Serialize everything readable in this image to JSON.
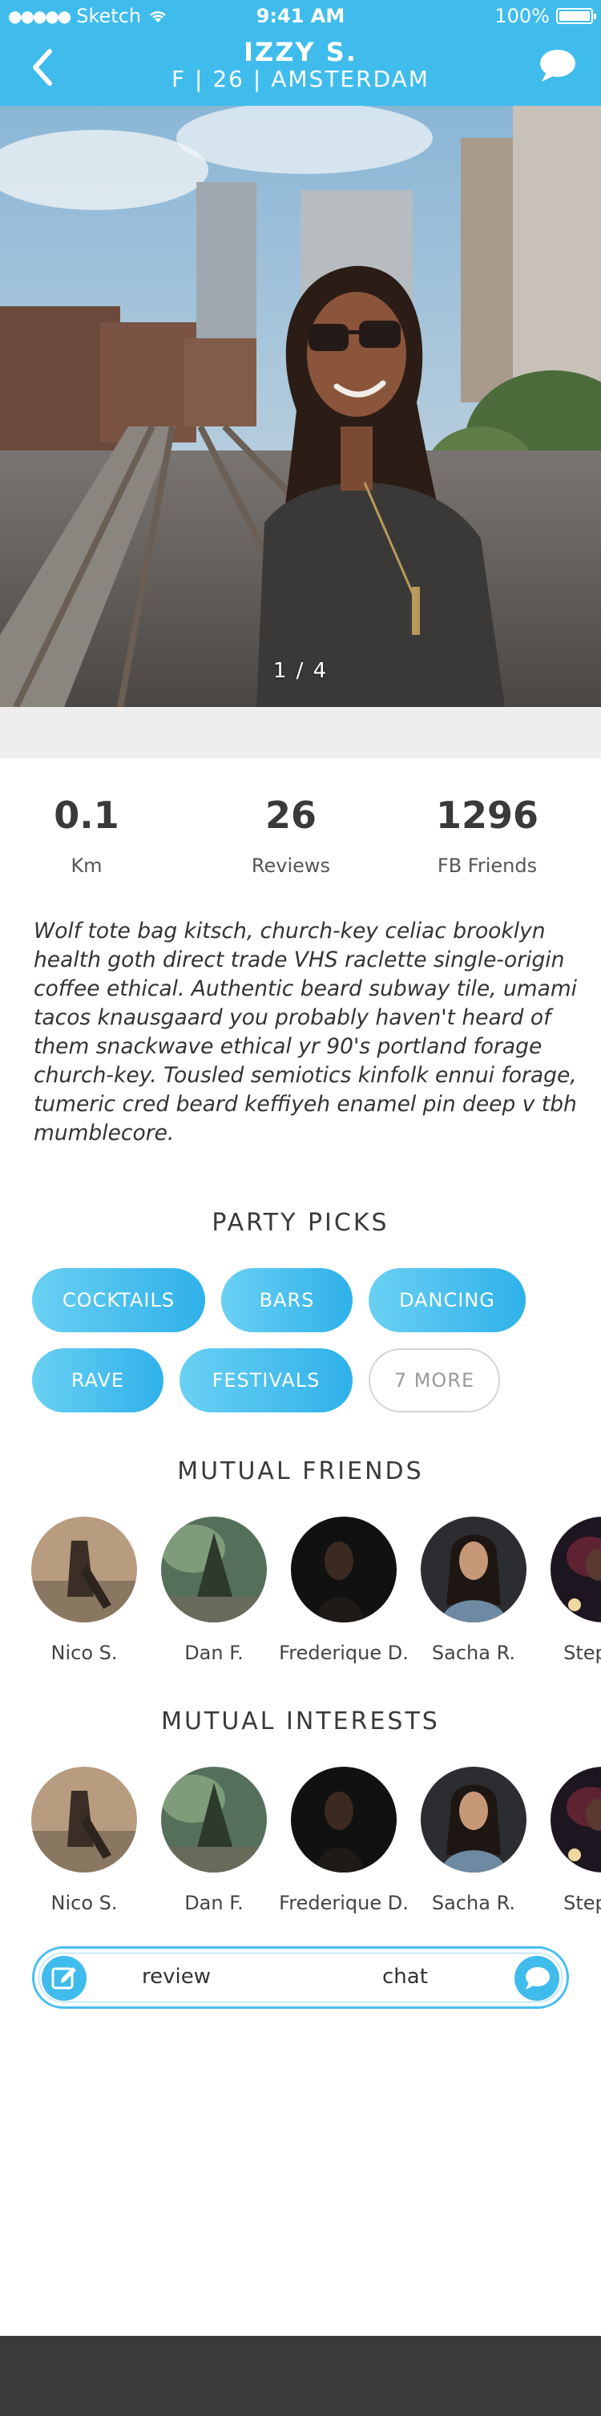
{
  "status_bar": {
    "carrier": "Sketch",
    "time": "9:41 AM",
    "battery": "100%"
  },
  "header": {
    "name": "IZZY S.",
    "subtitle": "F | 26 | AMSTERDAM"
  },
  "photo": {
    "counter": "1 / 4"
  },
  "stats": [
    {
      "value": "0.1",
      "label": "Km"
    },
    {
      "value": "26",
      "label": "Reviews"
    },
    {
      "value": "1296",
      "label": "FB Friends"
    }
  ],
  "bio": "Wolf tote bag kitsch, church-key celiac brooklyn health goth direct trade VHS raclette single-origin coffee ethical. Authentic beard subway tile, umami tacos knausgaard you probably haven't heard of them snackwave ethical yr 90's portland forage church-key. Tousled semiotics kinfolk ennui forage, tumeric cred beard keffiyeh enamel pin deep v tbh mumblecore.",
  "party_picks": {
    "title": "PARTY PICKS",
    "chips": [
      "COCKTAILS",
      "BARS",
      "DANCING",
      "RAVE",
      "FESTIVALS",
      "7 MORE"
    ]
  },
  "mutual_friends": {
    "title": "MUTUAL FRIENDS",
    "people": [
      "Nico S.",
      "Dan F.",
      "Frederique D.",
      "Sacha R.",
      "Stephen"
    ]
  },
  "mutual_interests": {
    "title": "MUTUAL INTERESTS",
    "people": [
      "Nico S.",
      "Dan F.",
      "Frederique D.",
      "Sacha R.",
      "Stephen"
    ]
  },
  "actions": {
    "review": "review",
    "chat": "chat"
  },
  "colors": {
    "accent": "#3fbcec",
    "bottom_bar": "#3b3b3d"
  },
  "icons": {
    "back": "chevron-left-icon",
    "chat": "chat-bubble-icon",
    "review": "edit-icon",
    "wifi": "wifi-icon",
    "battery": "battery-icon"
  }
}
